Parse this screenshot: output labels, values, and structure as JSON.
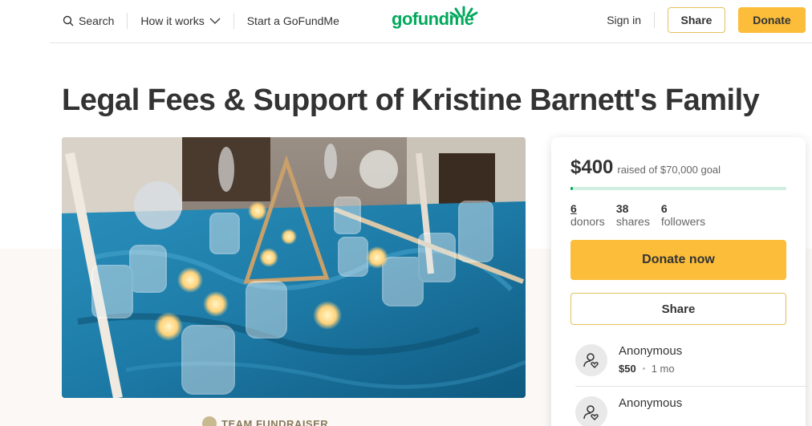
{
  "header": {
    "search_label": "Search",
    "how_it_works_label": "How it works",
    "start_label": "Start a GoFundMe",
    "logo_text": "gofundme",
    "signin_label": "Sign in",
    "share_label": "Share",
    "donate_label": "Donate"
  },
  "campaign": {
    "title": "Legal Fees & Support of Kristine Barnett's Family",
    "team_label": "TEAM FUNDRAISER"
  },
  "card": {
    "raised": "$400",
    "goal_text": "raised of $70,000 goal",
    "progress_fraction": 0.0057,
    "donors_count": "6",
    "donors_label": "donors",
    "shares_count": "38",
    "shares_label": "shares",
    "followers_count": "6",
    "followers_label": "followers",
    "donate_now_label": "Donate now",
    "share_label": "Share",
    "donations": [
      {
        "name": "Anonymous",
        "amount": "$50",
        "time": "1 mo"
      },
      {
        "name": "Anonymous"
      }
    ]
  },
  "colors": {
    "brand_green": "#02a95c",
    "donate_yellow": "#fbbd3a",
    "table_blue": "#1f7fa8"
  },
  "icons": [
    "search-icon",
    "chevron-down-icon",
    "user-heart-icon"
  ]
}
